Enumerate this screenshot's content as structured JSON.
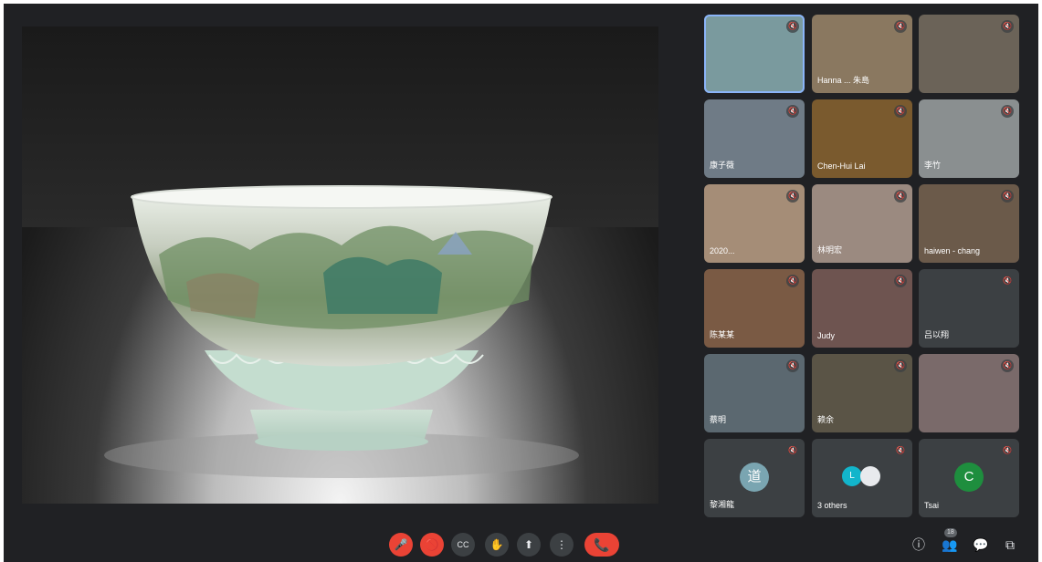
{
  "participants": [
    {
      "name": "",
      "color": "#7a9a9e",
      "active": true
    },
    {
      "name": "Hanna ... 朱島",
      "color": "#8a7860"
    },
    {
      "name": "",
      "color": "#6b6358"
    },
    {
      "name": "康子薇",
      "color": "#6f7b86"
    },
    {
      "name": "Chen-Hui Lai",
      "color": "#7a5a2e"
    },
    {
      "name": "李竹",
      "color": "#8a8f90"
    },
    {
      "name": "2020...",
      "color": "#a58d77"
    },
    {
      "name": "林明宏",
      "color": "#9b8a80"
    },
    {
      "name": "haiwen - chang",
      "color": "#6b5a4a"
    },
    {
      "name": "陈某某",
      "color": "#7a5a44"
    },
    {
      "name": "Judy",
      "color": "#6e5450"
    },
    {
      "name": "吕以翔",
      "color": "#3c4043"
    },
    {
      "name": "蔡明",
      "color": "#5b6870"
    },
    {
      "name": "赖余",
      "color": "#5a5446"
    },
    {
      "name": "",
      "color": "#7a6a6a"
    },
    {
      "name": "黎湘龍",
      "color": "#3c4043"
    },
    {
      "name": "3 others",
      "color": "#3c4043"
    },
    {
      "name": "Tsai",
      "color": "#3c4043"
    }
  ],
  "avatars": {
    "avatar_15": {
      "initial": "道",
      "color": "#7aa5b1"
    },
    "avatar_17": {
      "initial": "C",
      "color": "#1e8e3e"
    },
    "avatar_16a": {
      "initial": "L",
      "color": "#12b5cb"
    },
    "avatar_16b": {
      "initial": "",
      "color": "#e8eaed"
    }
  },
  "controls": {
    "mic_icon": "🎤",
    "cam_icon": "🚫",
    "captions_icon": "CC",
    "hand_icon": "✋",
    "present_icon": "⬆",
    "more_icon": "⋮",
    "end_icon": "📞"
  },
  "right_panel": {
    "participant_count": "18",
    "info_icon": "ⓘ",
    "people_icon": "👥",
    "chat_icon": "💬",
    "activities_icon": "⧉"
  },
  "colors": {
    "background": "#202124",
    "tile": "#3c4043",
    "danger": "#ea4335",
    "active_border": "#8ab4f8"
  }
}
